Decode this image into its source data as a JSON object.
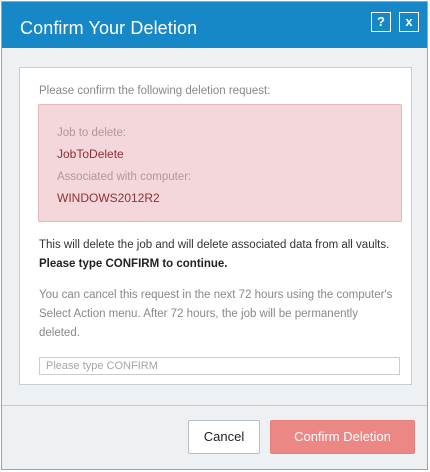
{
  "dialog": {
    "title": "Confirm Your Deletion",
    "help_label": "?",
    "close_label": "x",
    "intro": "Please confirm the following deletion request:",
    "job_label": "Job to delete:",
    "job_value": "JobToDelete",
    "computer_label": "Associated with computer:",
    "computer_value": "WINDOWS2012R2",
    "warning_text": "This will delete the job and will delete associated data from all vaults. ",
    "warning_bold": "Please type CONFIRM to continue.",
    "cancel_info": "You can cancel this request in the next 72 hours using the computer's Select Action menu. After 72 hours, the job will be permanently deleted.",
    "input_placeholder": "Please type CONFIRM",
    "input_value": ""
  },
  "buttons": {
    "cancel": "Cancel",
    "confirm": "Confirm Deletion"
  },
  "colors": {
    "titlebar": "#1687c7",
    "confirm_button": "#eb8784",
    "highlight_box": "#f4d7da",
    "highlight_value": "#8f2f36"
  }
}
